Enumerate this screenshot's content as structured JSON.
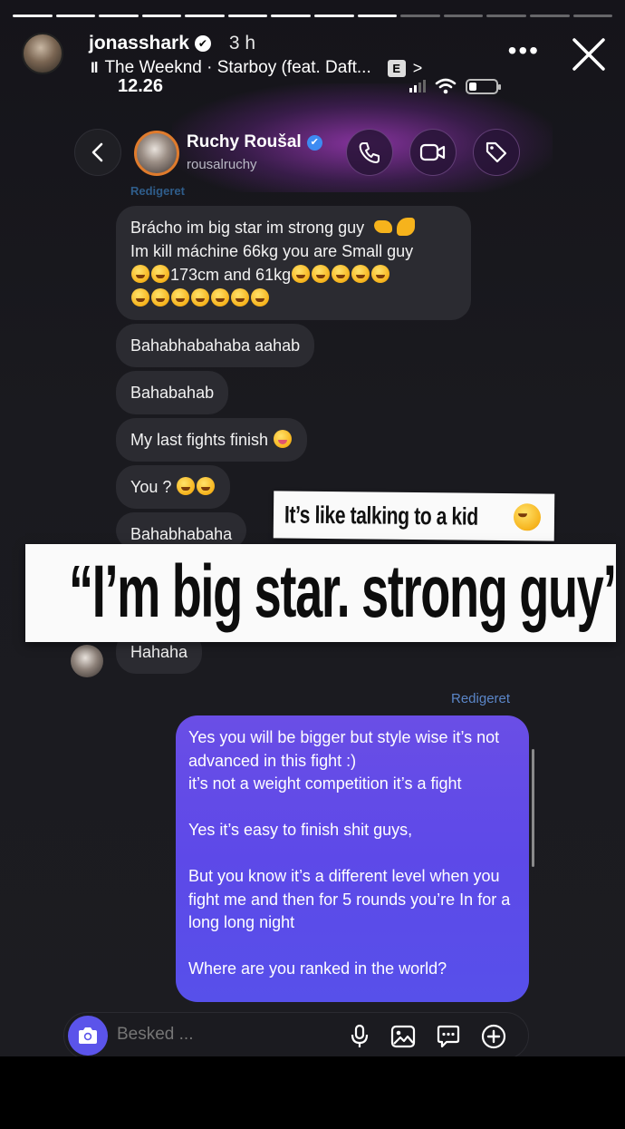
{
  "story": {
    "username": "jonasshark",
    "verified_mark": "✔",
    "time_ago": "3 h",
    "music": {
      "bars_glyph": "Il",
      "text": "The Weeknd · Starboy (feat. Daft...",
      "explicit_badge": "E",
      "chevron": ">"
    },
    "more_glyph": "•••",
    "progress_segments_total": 14,
    "progress_segments_done": 9
  },
  "status_bar": {
    "time": "12.26",
    "battery_level": 0.25
  },
  "chat": {
    "contact_name": "Ruchy Roušal",
    "verified_mark": "✔",
    "contact_handle": "rousalruchy",
    "edited_ghost": "Redigeret",
    "messages_incoming": [
      {
        "lines": [
          "Brácho im big star im strong guy 🤏💪",
          "Im kill máchine 66kg you are Small guy",
          "🤣🤣173cm and 61kg🤣🤣🤣🤣🤣",
          "🤣🤣🤣🤣🤣🤣🤣"
        ]
      },
      {
        "text": "Bahabhabahaba aahab"
      },
      {
        "text": "Bahabahab"
      },
      {
        "text": "My last fights finish 😝"
      },
      {
        "text": "You ? 🤣🤣"
      },
      {
        "text": "Bahabhabaha"
      },
      {
        "text": "Hahaha"
      }
    ],
    "edited_label": "Redigeret",
    "outgoing_message": "Yes you will be bigger but style wise it’s not advanced in this fight :)\n it’s not a weight competition it’s a fight\n\nYes it’s easy to finish shit guys,\n\nBut you know it’s a different level when you fight me and then for 5 rounds you’re In for a long long night\n\nWhere are you ranked in the world?",
    "composer_placeholder": "Besked ..."
  },
  "overlays": {
    "small_sticker": "It’s like talking to a kid",
    "big_quote": "“I’m big star. strong guy”"
  },
  "icons": {
    "close": "close-icon",
    "back": "chevron-left-icon",
    "call": "phone-icon",
    "video": "video-icon",
    "tag": "tag-icon",
    "camera": "camera-icon",
    "mic": "microphone-icon",
    "gallery": "image-icon",
    "sticker": "chat-sticker-icon",
    "add": "plus-circle-icon"
  },
  "colors": {
    "outgoing_bubble": "#5d49e8",
    "incoming_bubble": "#2b2b31",
    "verified_blue": "#3d8bf2",
    "edited_label": "#5b86c8",
    "avatar_ring": "#e07b2c"
  }
}
